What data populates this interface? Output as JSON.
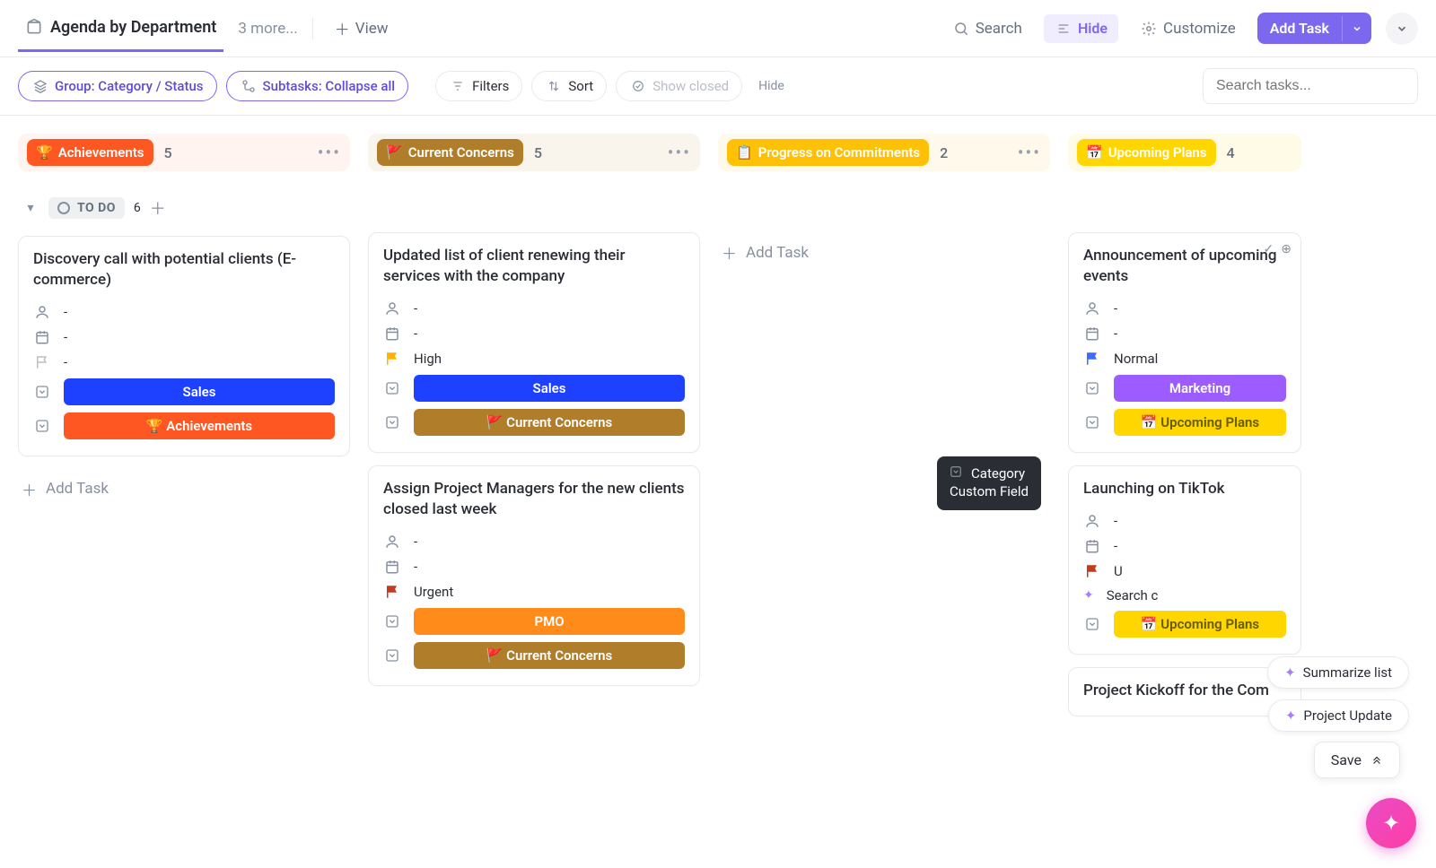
{
  "topbar": {
    "view_name": "Agenda by Department",
    "more_views": "3 more...",
    "add_view": "View",
    "search": "Search",
    "hide": "Hide",
    "customize": "Customize",
    "add_task": "Add Task"
  },
  "filters": {
    "group": "Group: Category / Status",
    "subtasks": "Subtasks: Collapse all",
    "filters": "Filters",
    "sort": "Sort",
    "show_closed": "Show closed",
    "hide": "Hide",
    "search_placeholder": "Search tasks..."
  },
  "columns": [
    {
      "emoji": "🏆",
      "label": "Achievements",
      "count": "5",
      "pill_class": "bg-ach",
      "hdr_class": "hdr-ach"
    },
    {
      "emoji": "🚩",
      "label": "Current Concerns",
      "count": "5",
      "pill_class": "bg-con",
      "hdr_class": "hdr-con"
    },
    {
      "emoji": "📋",
      "label": "Progress on Commitments",
      "count": "2",
      "pill_class": "bg-prog",
      "hdr_class": "hdr-prog"
    },
    {
      "emoji": "📅",
      "label": "Upcoming Plans",
      "count": "4",
      "pill_class": "bg-plan",
      "hdr_class": "hdr-plan"
    }
  ],
  "status": {
    "label": "TO DO",
    "count": "6"
  },
  "cards": {
    "c0_0": {
      "title": "Discovery call with potential clients (E-commerce)",
      "assignee": "-",
      "date": "-",
      "priority": "-",
      "dept": "Sales",
      "dept_class": "tag-sales",
      "cat": "🏆 Achievements",
      "cat_class": "tag-ach",
      "flag_color": "#b9bec7"
    },
    "c1_0": {
      "title": "Updated list of client renewing their services with the company",
      "assignee": "-",
      "date": "-",
      "priority": "High",
      "dept": "Sales",
      "dept_class": "tag-sales",
      "cat": "🚩 Current Concerns",
      "cat_class": "tag-con",
      "flag_color": "#ffb300"
    },
    "c1_1": {
      "title": "Assign Project Managers for the new clients closed last week",
      "assignee": "-",
      "date": "-",
      "priority": "Urgent",
      "dept": "PMO",
      "dept_class": "tag-pmo",
      "cat": "🚩 Current Concerns",
      "cat_class": "tag-con",
      "flag_color": "#c23b22"
    },
    "c3_0": {
      "title": "Announcement of upcoming events",
      "assignee": "-",
      "date": "-",
      "priority": "Normal",
      "dept": "Marketing",
      "dept_class": "tag-mkt",
      "cat": "📅 Upcoming Plans",
      "cat_class": "tag-plan",
      "flag_color": "#3a6cff"
    },
    "c3_1": {
      "title": "Launching on TikTok",
      "assignee": "-",
      "date": "-",
      "priority": "U",
      "dept": "",
      "dept_class": "tag-mkt",
      "cat": "📅 Upcoming Plans",
      "cat_class": "tag-plan",
      "flag_color": "#c23b22"
    },
    "c3_2": {
      "title": "Project Kickoff for the Com"
    }
  },
  "add_task_inline": "Add Task",
  "tooltip": {
    "line1": "Category",
    "line2": "Custom Field"
  },
  "ai": {
    "summarize": "Summarize list",
    "project_update": "Project Update",
    "search": "Search c",
    "save": "Save"
  }
}
